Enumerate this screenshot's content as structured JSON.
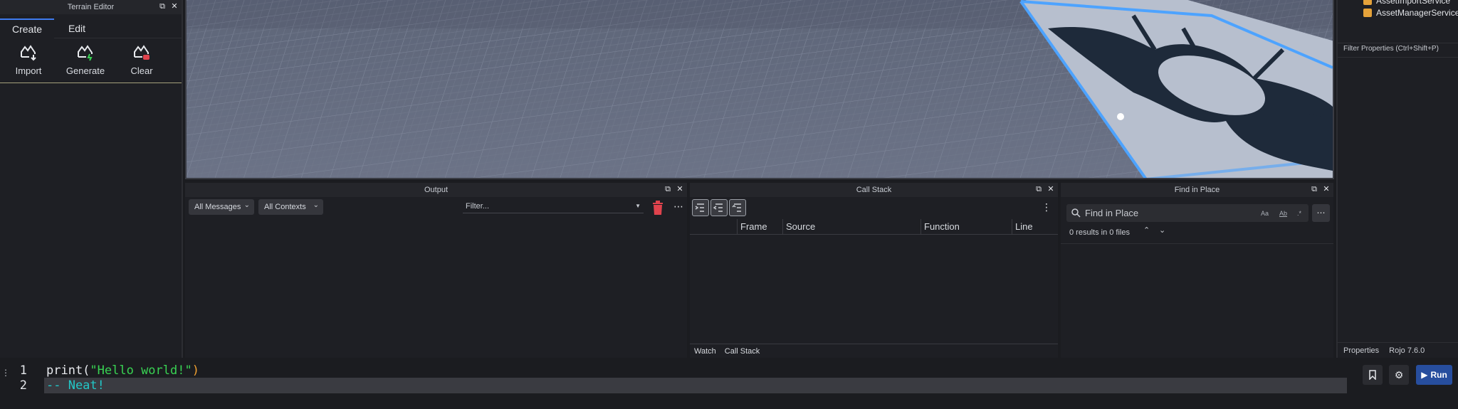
{
  "terrain_editor": {
    "title": "Terrain Editor",
    "tabs": [
      "Create",
      "Edit"
    ],
    "tools": [
      "Import",
      "Generate",
      "Clear"
    ]
  },
  "explorer": {
    "items": [
      "AssetImportService",
      "AssetManagerService"
    ],
    "filter_properties": "Filter Properties (Ctrl+Shift+P)",
    "bottom_tabs": [
      "Properties",
      "Rojo 7.6.0"
    ]
  },
  "output": {
    "title": "Output",
    "messages_dropdown": "All Messages",
    "contexts_dropdown": "All Contexts",
    "filter_placeholder": "Filter..."
  },
  "callstack": {
    "title": "Call Stack",
    "columns": [
      "Frame",
      "Source",
      "Function",
      "Line"
    ],
    "bottom_tabs": [
      "Watch",
      "Call Stack"
    ]
  },
  "find": {
    "title": "Find in Place",
    "placeholder": "Find in Place",
    "option_case": "Aa",
    "option_word": "Ab",
    "results": "0 results in 0 files"
  },
  "editor": {
    "lines": [
      {
        "number": "1",
        "prefix": "print(",
        "string": "\"Hello world!\"",
        "suffix": ")"
      },
      {
        "number": "2",
        "comment": "-- Neat!"
      }
    ],
    "run_label": "Run"
  },
  "colors": {
    "accent": "#3e7bf0",
    "string": "#39d353",
    "comment": "#22c8c8",
    "paren": "#f0a030",
    "selection": "#4da3ff",
    "run_button": "#274e9e"
  }
}
